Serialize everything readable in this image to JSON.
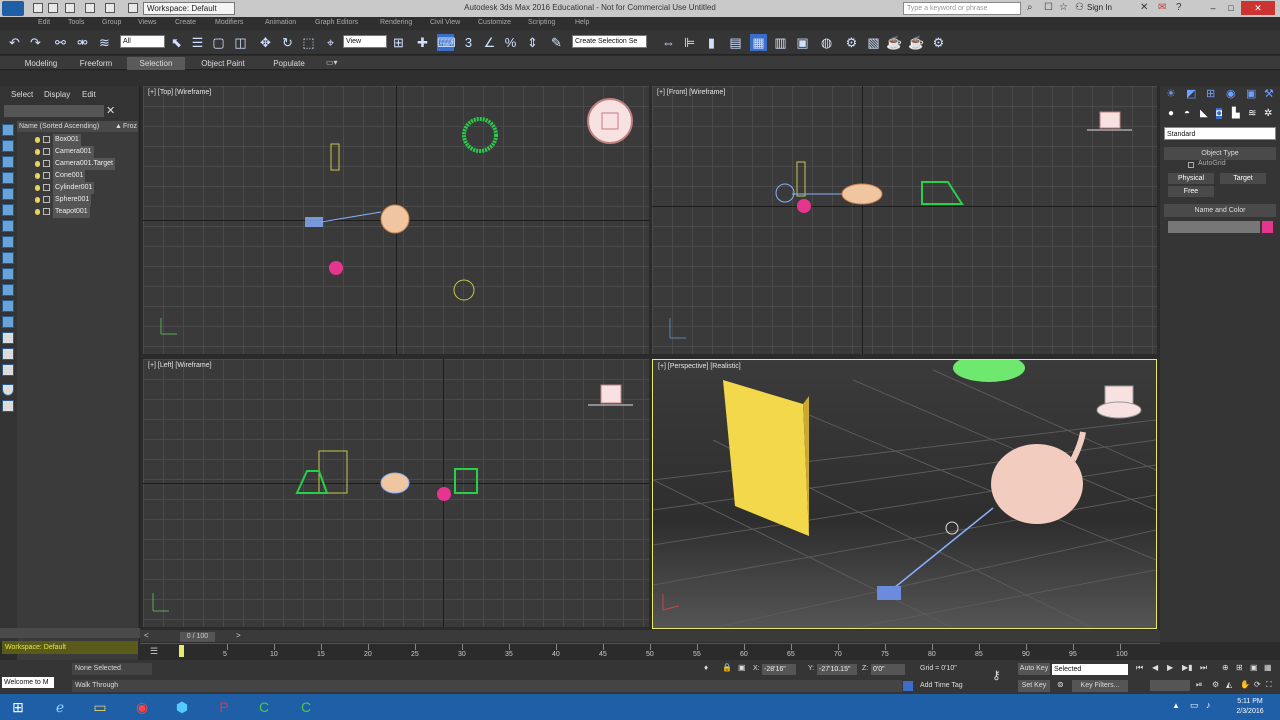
{
  "title_bar": {
    "workspace": "Workspace: Default",
    "app_title": "Autodesk 3ds Max 2016 Educational - Not for Commercial Use   Untitled",
    "search_placeholder": "Type a keyword or phrase",
    "sign_in": "Sign In"
  },
  "menu": [
    "Edit",
    "Tools",
    "Group",
    "Views",
    "Create",
    "Modifiers",
    "Animation",
    "Graph Editors",
    "Rendering",
    "Civil View",
    "Customize",
    "Scripting",
    "Help"
  ],
  "toolbar": {
    "selection_filter": "All",
    "ref_coord": "View",
    "selection_set": "Create Selection Se"
  },
  "ribbon_tabs": [
    {
      "label": "Modeling",
      "active": false
    },
    {
      "label": "Freeform",
      "active": false
    },
    {
      "label": "Selection",
      "active": true
    },
    {
      "label": "Object Paint",
      "active": false
    },
    {
      "label": "Populate",
      "active": false
    }
  ],
  "explorer": {
    "menu": [
      "Select",
      "Display",
      "Edit"
    ],
    "header": "Name (Sorted Ascending)",
    "header_right": "Froz",
    "items": [
      "Box001",
      "Camera001",
      "Camera001.Target",
      "Cone001",
      "Cylinder001",
      "Sphere001",
      "Teapot001"
    ],
    "workspace_label": "Workspace: Default"
  },
  "viewports": {
    "top": "[+] [Top] [Wireframe]",
    "front": "[+] [Front] [Wireframe]",
    "left": "[+] [Left] [Wireframe]",
    "perspective": "[+] [Perspective] [Realistic]"
  },
  "command_panel": {
    "category": "Standard",
    "object_type": "Object Type",
    "autogrid": "AutoGrid",
    "physical": "Physical",
    "target": "Target",
    "free": "Free",
    "name_and_color": "Name and Color"
  },
  "timeline": {
    "frame": "0 / 100",
    "ticks": [
      "5",
      "10",
      "15",
      "20",
      "25",
      "30",
      "35",
      "40",
      "45",
      "50",
      "55",
      "60",
      "65",
      "70",
      "75",
      "80",
      "85",
      "90",
      "95",
      "100"
    ]
  },
  "status": {
    "maxscript": "Welcome to M",
    "selection": "None Selected",
    "prompt": "Walk Through",
    "x_label": "X:",
    "x": "-28'16\"",
    "y_label": "Y:",
    "y": "-27'10.15\"",
    "z_label": "Z:",
    "z": "0'0\"",
    "grid": "Grid = 0'10\"",
    "add_time_tag": "Add Time Tag",
    "auto_key": "Auto Key",
    "set_key": "Set Key",
    "selected": "Selected",
    "key_filters": "Key Filters..."
  },
  "clock": {
    "time": "5:11 PM",
    "date": "2/3/2016"
  },
  "colors": {
    "accent": "#1f5fa8",
    "viewport_bg": "#3a3a3a",
    "active_border": "#e8e86a"
  }
}
